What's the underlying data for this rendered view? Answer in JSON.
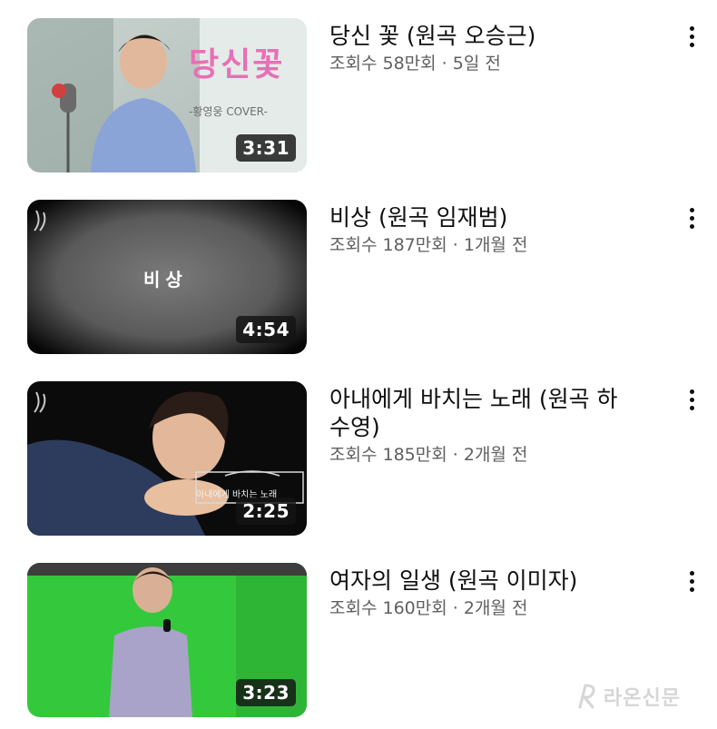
{
  "videos": [
    {
      "title": "당신 꽃 (원곡 오승근)",
      "views": "조회수 58만회",
      "separator": "·",
      "age": "5일 전",
      "duration": "3:31",
      "thumb_text": "당신꽃",
      "thumb_sub": "-황영웅 COVER-"
    },
    {
      "title": "비상 (원곡 임재범)",
      "views": "조회수 187만회",
      "separator": "·",
      "age": "1개월 전",
      "duration": "4:54",
      "thumb_text": "비상"
    },
    {
      "title": "아내에게 바치는 노래 (원곡 하수영)",
      "views": "조회수 185만회",
      "separator": "·",
      "age": "2개월 전",
      "duration": "2:25",
      "thumb_text": "아내에게 바치는 노래"
    },
    {
      "title": "여자의 일생 (원곡 이미자)",
      "views": "조회수 160만회",
      "separator": "·",
      "age": "2개월 전",
      "duration": "3:23"
    }
  ],
  "watermark": "라온신문",
  "colors": {
    "title": "#0f0f0f",
    "meta": "#606060",
    "duration_bg": "#141414",
    "thumb_pink": "#e86fb6",
    "thumb_green": "#34c93c"
  }
}
